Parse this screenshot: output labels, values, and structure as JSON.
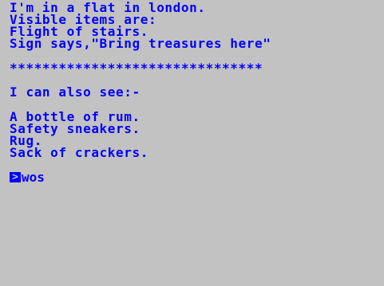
{
  "colors": {
    "background": "#c2c2c2",
    "text": "#0000ff"
  },
  "location": {
    "line1": "I'm in a flat in london.",
    "line2": "Visible items are:",
    "line3": "Flight of stairs.",
    "line4": "Sign says,\"Bring treasures here\""
  },
  "separator": "*******************************",
  "also_see": {
    "heading": "I can also see:-",
    "items": [
      "A bottle of rum.",
      "Safety sneakers.",
      "Rug.",
      "Sack of crackers."
    ]
  },
  "prompt": {
    "cursor_glyph": ">",
    "command": "wos"
  }
}
